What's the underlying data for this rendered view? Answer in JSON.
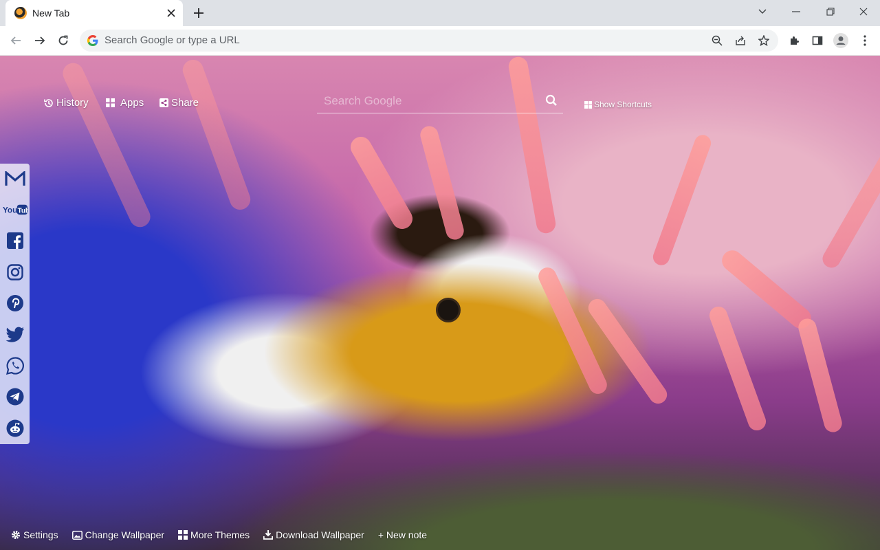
{
  "tab": {
    "title": "New Tab"
  },
  "omnibox": {
    "placeholder": "Search Google or type a URL"
  },
  "nav": {
    "history": "History",
    "apps": "Apps",
    "share": "Share",
    "show_shortcuts": "Show Shortcuts"
  },
  "search": {
    "placeholder": "Search Google"
  },
  "social": [
    "gmail",
    "youtube",
    "facebook",
    "instagram",
    "pinterest",
    "twitter",
    "whatsapp",
    "telegram",
    "reddit"
  ],
  "bottom": {
    "settings": "Settings",
    "change_wallpaper": "Change Wallpaper",
    "more_themes": "More Themes",
    "download_wallpaper": "Download Wallpaper",
    "new_note": "+ New note"
  },
  "colors": {
    "social_icon": "#1d3a8a",
    "chrome_bg": "#dee1e6",
    "omnibox_bg": "#f1f3f4"
  }
}
